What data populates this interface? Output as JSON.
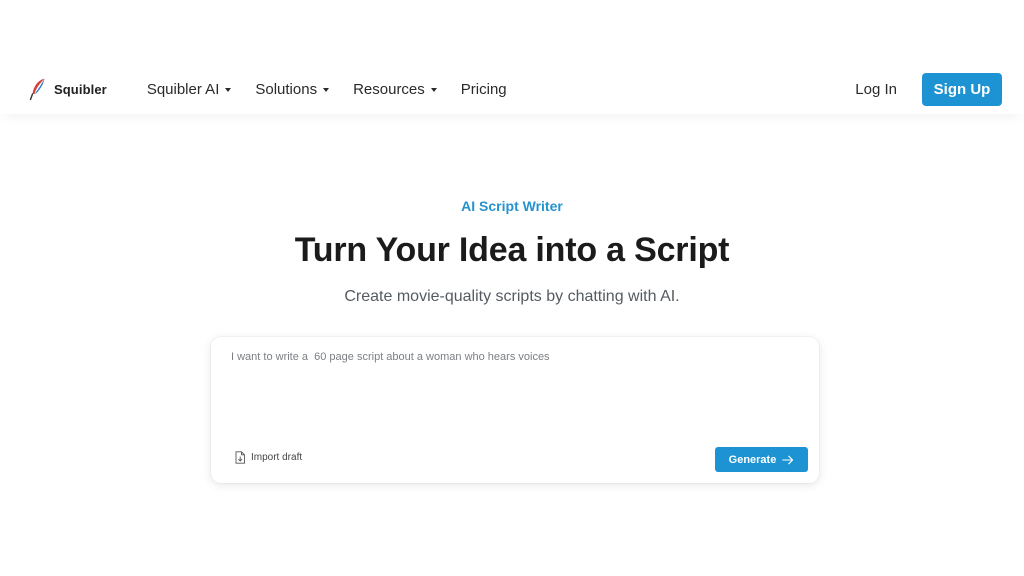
{
  "header": {
    "logo_text": "Squibler",
    "logo_icon": "quill-feather-icon",
    "nav": [
      {
        "label": "Squibler AI",
        "has_dropdown": true
      },
      {
        "label": "Solutions",
        "has_dropdown": true
      },
      {
        "label": "Resources",
        "has_dropdown": true
      },
      {
        "label": "Pricing",
        "has_dropdown": false
      }
    ],
    "login_label": "Log In",
    "signup_label": "Sign Up"
  },
  "hero": {
    "eyebrow": "AI Script Writer",
    "title": "Turn Your Idea into a Script",
    "subtitle": "Create movie-quality scripts by chatting with AI."
  },
  "prompt": {
    "placeholder": "I want to write a  60 page script about a woman who hears voices",
    "value": "",
    "import_label": "Import draft",
    "generate_label": "Generate"
  },
  "colors": {
    "accent": "#1d93d4",
    "eyebrow": "#2593cf",
    "headline": "#1b1b1b",
    "subtext": "#555b61"
  }
}
